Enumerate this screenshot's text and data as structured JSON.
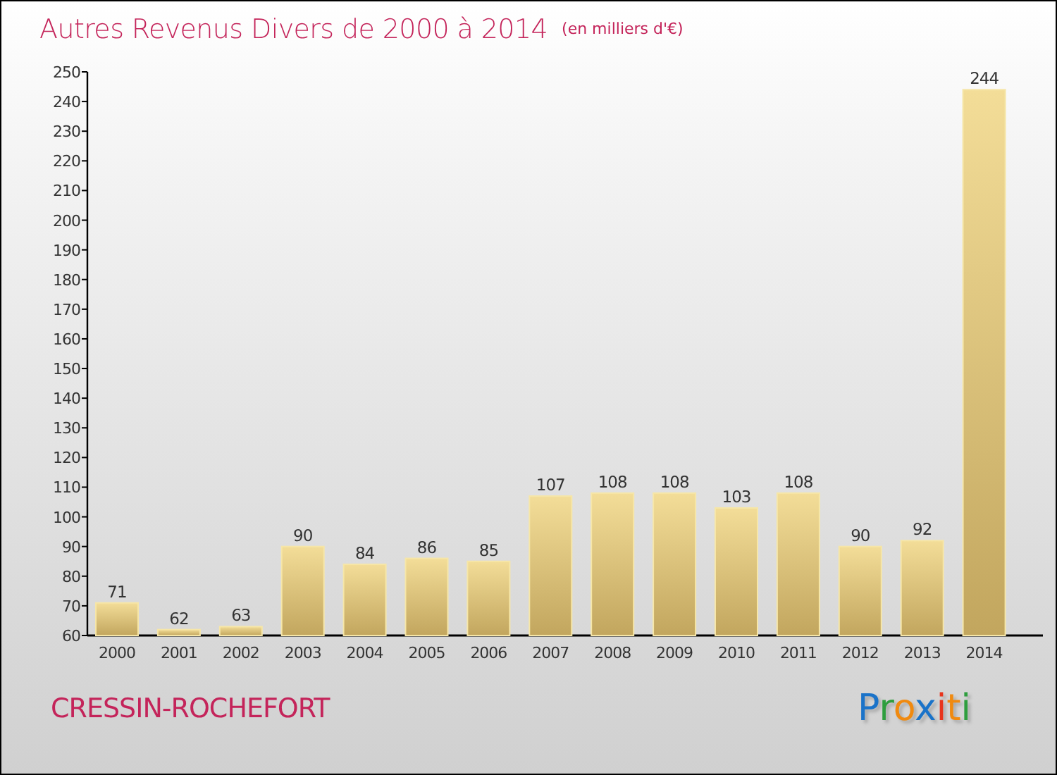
{
  "chart": {
    "unit": "(en milliers d'€)",
    "chart_data": {
      "type": "bar",
      "title": "Autres Revenus Divers de 2000 à 2014",
      "categories": [
        "2000",
        "2001",
        "2002",
        "2003",
        "2004",
        "2005",
        "2006",
        "2007",
        "2008",
        "2009",
        "2010",
        "2011",
        "2012",
        "2013",
        "2014"
      ],
      "values": [
        71,
        62,
        63,
        90,
        84,
        86,
        85,
        107,
        108,
        108,
        103,
        108,
        90,
        92,
        244
      ],
      "ylim": [
        60,
        250
      ],
      "yticks": [
        60,
        70,
        80,
        90,
        100,
        110,
        120,
        130,
        140,
        150,
        160,
        170,
        180,
        190,
        200,
        210,
        220,
        230,
        240,
        250
      ],
      "data_labels": true
    }
  },
  "footer": {
    "place": "CRESSIN-ROCHEFORT",
    "logo": "Proxiti"
  }
}
